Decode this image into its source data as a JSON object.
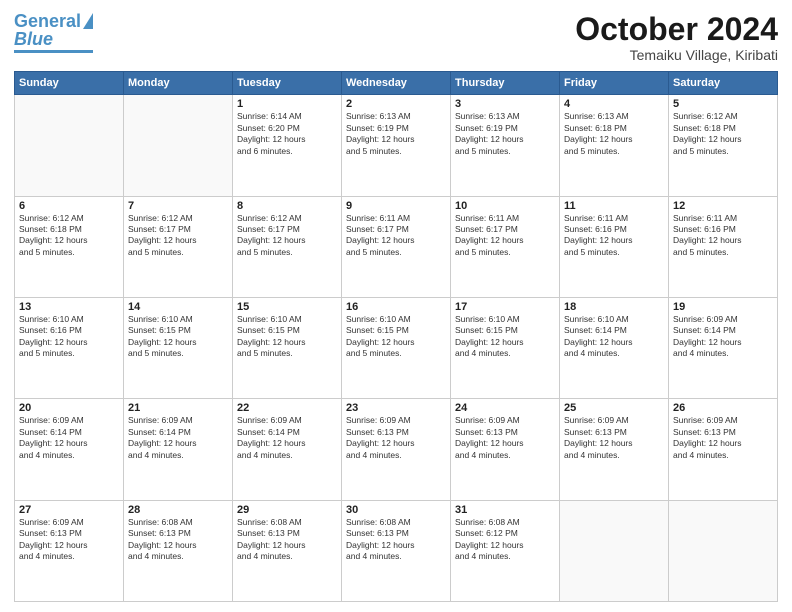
{
  "header": {
    "logo_general": "General",
    "logo_blue": "Blue",
    "month": "October 2024",
    "location": "Temaiku Village, Kiribati"
  },
  "weekdays": [
    "Sunday",
    "Monday",
    "Tuesday",
    "Wednesday",
    "Thursday",
    "Friday",
    "Saturday"
  ],
  "weeks": [
    [
      {
        "day": "",
        "content": ""
      },
      {
        "day": "",
        "content": ""
      },
      {
        "day": "1",
        "content": "Sunrise: 6:14 AM\nSunset: 6:20 PM\nDaylight: 12 hours\nand 6 minutes."
      },
      {
        "day": "2",
        "content": "Sunrise: 6:13 AM\nSunset: 6:19 PM\nDaylight: 12 hours\nand 5 minutes."
      },
      {
        "day": "3",
        "content": "Sunrise: 6:13 AM\nSunset: 6:19 PM\nDaylight: 12 hours\nand 5 minutes."
      },
      {
        "day": "4",
        "content": "Sunrise: 6:13 AM\nSunset: 6:18 PM\nDaylight: 12 hours\nand 5 minutes."
      },
      {
        "day": "5",
        "content": "Sunrise: 6:12 AM\nSunset: 6:18 PM\nDaylight: 12 hours\nand 5 minutes."
      }
    ],
    [
      {
        "day": "6",
        "content": "Sunrise: 6:12 AM\nSunset: 6:18 PM\nDaylight: 12 hours\nand 5 minutes."
      },
      {
        "day": "7",
        "content": "Sunrise: 6:12 AM\nSunset: 6:17 PM\nDaylight: 12 hours\nand 5 minutes."
      },
      {
        "day": "8",
        "content": "Sunrise: 6:12 AM\nSunset: 6:17 PM\nDaylight: 12 hours\nand 5 minutes."
      },
      {
        "day": "9",
        "content": "Sunrise: 6:11 AM\nSunset: 6:17 PM\nDaylight: 12 hours\nand 5 minutes."
      },
      {
        "day": "10",
        "content": "Sunrise: 6:11 AM\nSunset: 6:17 PM\nDaylight: 12 hours\nand 5 minutes."
      },
      {
        "day": "11",
        "content": "Sunrise: 6:11 AM\nSunset: 6:16 PM\nDaylight: 12 hours\nand 5 minutes."
      },
      {
        "day": "12",
        "content": "Sunrise: 6:11 AM\nSunset: 6:16 PM\nDaylight: 12 hours\nand 5 minutes."
      }
    ],
    [
      {
        "day": "13",
        "content": "Sunrise: 6:10 AM\nSunset: 6:16 PM\nDaylight: 12 hours\nand 5 minutes."
      },
      {
        "day": "14",
        "content": "Sunrise: 6:10 AM\nSunset: 6:15 PM\nDaylight: 12 hours\nand 5 minutes."
      },
      {
        "day": "15",
        "content": "Sunrise: 6:10 AM\nSunset: 6:15 PM\nDaylight: 12 hours\nand 5 minutes."
      },
      {
        "day": "16",
        "content": "Sunrise: 6:10 AM\nSunset: 6:15 PM\nDaylight: 12 hours\nand 5 minutes."
      },
      {
        "day": "17",
        "content": "Sunrise: 6:10 AM\nSunset: 6:15 PM\nDaylight: 12 hours\nand 4 minutes."
      },
      {
        "day": "18",
        "content": "Sunrise: 6:10 AM\nSunset: 6:14 PM\nDaylight: 12 hours\nand 4 minutes."
      },
      {
        "day": "19",
        "content": "Sunrise: 6:09 AM\nSunset: 6:14 PM\nDaylight: 12 hours\nand 4 minutes."
      }
    ],
    [
      {
        "day": "20",
        "content": "Sunrise: 6:09 AM\nSunset: 6:14 PM\nDaylight: 12 hours\nand 4 minutes."
      },
      {
        "day": "21",
        "content": "Sunrise: 6:09 AM\nSunset: 6:14 PM\nDaylight: 12 hours\nand 4 minutes."
      },
      {
        "day": "22",
        "content": "Sunrise: 6:09 AM\nSunset: 6:14 PM\nDaylight: 12 hours\nand 4 minutes."
      },
      {
        "day": "23",
        "content": "Sunrise: 6:09 AM\nSunset: 6:13 PM\nDaylight: 12 hours\nand 4 minutes."
      },
      {
        "day": "24",
        "content": "Sunrise: 6:09 AM\nSunset: 6:13 PM\nDaylight: 12 hours\nand 4 minutes."
      },
      {
        "day": "25",
        "content": "Sunrise: 6:09 AM\nSunset: 6:13 PM\nDaylight: 12 hours\nand 4 minutes."
      },
      {
        "day": "26",
        "content": "Sunrise: 6:09 AM\nSunset: 6:13 PM\nDaylight: 12 hours\nand 4 minutes."
      }
    ],
    [
      {
        "day": "27",
        "content": "Sunrise: 6:09 AM\nSunset: 6:13 PM\nDaylight: 12 hours\nand 4 minutes."
      },
      {
        "day": "28",
        "content": "Sunrise: 6:08 AM\nSunset: 6:13 PM\nDaylight: 12 hours\nand 4 minutes."
      },
      {
        "day": "29",
        "content": "Sunrise: 6:08 AM\nSunset: 6:13 PM\nDaylight: 12 hours\nand 4 minutes."
      },
      {
        "day": "30",
        "content": "Sunrise: 6:08 AM\nSunset: 6:13 PM\nDaylight: 12 hours\nand 4 minutes."
      },
      {
        "day": "31",
        "content": "Sunrise: 6:08 AM\nSunset: 6:12 PM\nDaylight: 12 hours\nand 4 minutes."
      },
      {
        "day": "",
        "content": ""
      },
      {
        "day": "",
        "content": ""
      }
    ]
  ]
}
